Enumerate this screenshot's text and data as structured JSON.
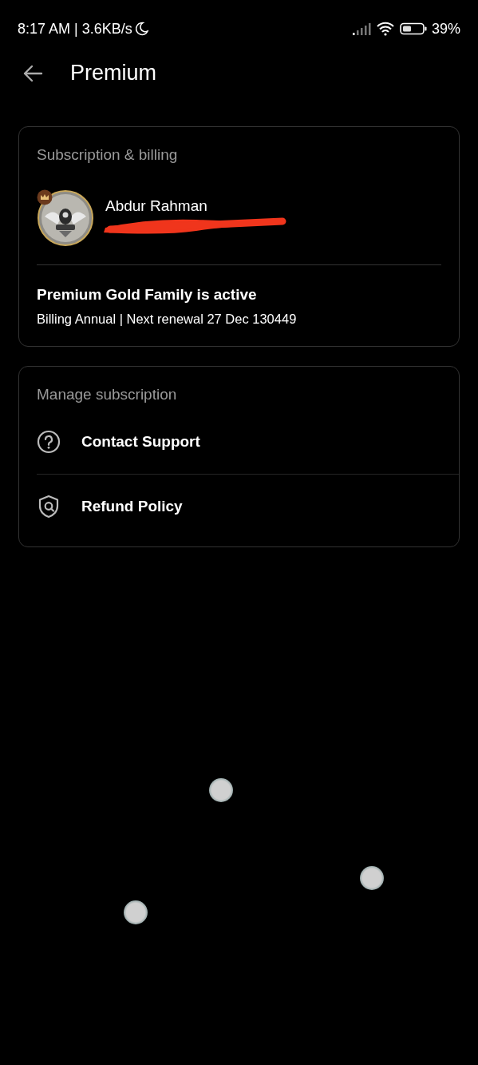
{
  "status_bar": {
    "time": "8:17 AM | 3.6KB/s",
    "battery": "39%"
  },
  "header": {
    "title": "Premium"
  },
  "subscription_card": {
    "heading": "Subscription & billing",
    "user_name": "Abdur Rahman",
    "plan": "Premium Gold Family is active",
    "billing": "Billing Annual | Next renewal 27 Dec 130449"
  },
  "manage_card": {
    "heading": "Manage subscription",
    "items": [
      {
        "kind": "help",
        "label": "Contact Support"
      },
      {
        "kind": "shield",
        "label": "Refund Policy"
      }
    ]
  }
}
